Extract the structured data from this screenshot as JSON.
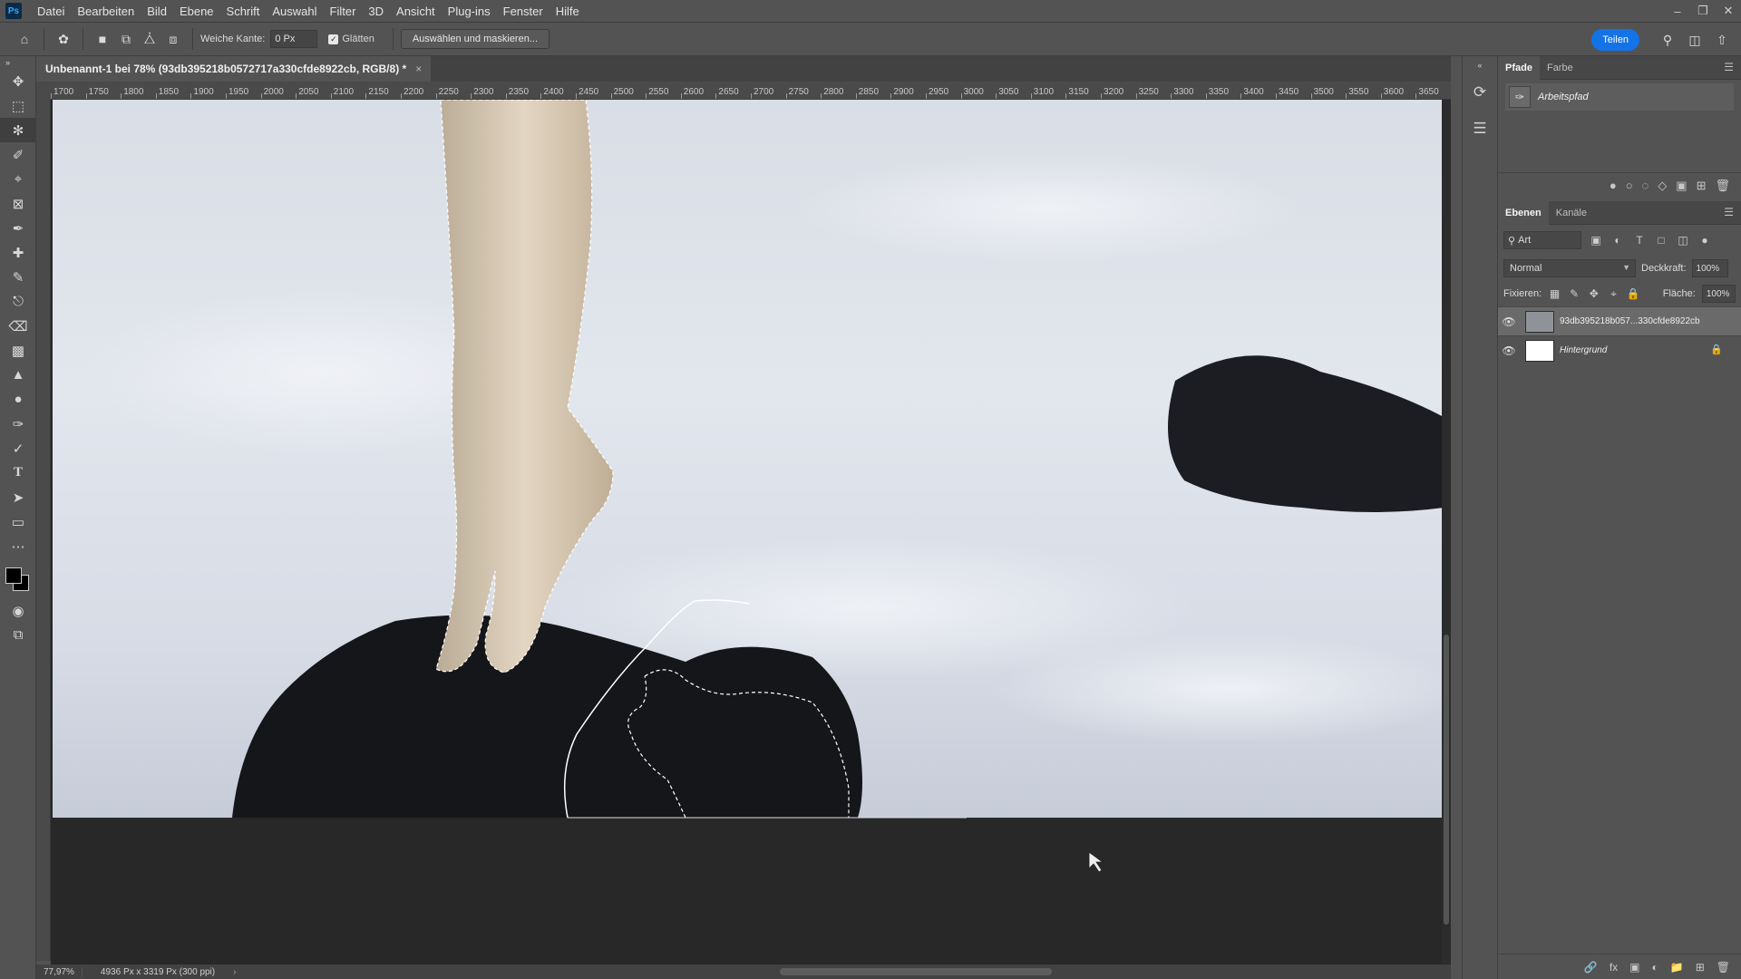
{
  "app": {
    "logo": "Ps"
  },
  "menu": [
    "Datei",
    "Bearbeiten",
    "Bild",
    "Ebene",
    "Schrift",
    "Auswahl",
    "Filter",
    "3D",
    "Ansicht",
    "Plug-ins",
    "Fenster",
    "Hilfe"
  ],
  "options": {
    "feather_label": "Weiche Kante:",
    "feather_value": "0 Px",
    "antialias_label": "Glätten",
    "select_mask_button": "Auswählen und maskieren...",
    "share_button": "Teilen"
  },
  "document": {
    "tab_title": "Unbenannt-1 bei 78% (93db395218b0572717a330cfde8922cb, RGB/8) *",
    "close_glyph": "×"
  },
  "ruler": {
    "ticks": [
      "1700",
      "1750",
      "1800",
      "1850",
      "1900",
      "1950",
      "2000",
      "2050",
      "2100",
      "2150",
      "2200",
      "2250",
      "2300",
      "2350",
      "2400",
      "2450",
      "2500",
      "2550",
      "2600",
      "2650",
      "2700",
      "2750",
      "2800",
      "2850",
      "2900",
      "2950",
      "3000",
      "3050",
      "3100",
      "3150",
      "3200",
      "3250",
      "3300",
      "3350",
      "3400",
      "3450",
      "3500",
      "3550",
      "3600",
      "3650"
    ]
  },
  "status": {
    "zoom": "77,97%",
    "doc_info": "4936 Px x 3319 Px (300 ppi)"
  },
  "paths_panel": {
    "tabs": [
      "Pfade",
      "Farbe"
    ],
    "items": [
      {
        "name": "Arbeitspfad"
      }
    ]
  },
  "layers_panel": {
    "tabs": [
      "Ebenen",
      "Kanäle"
    ],
    "filter_kind": "Art",
    "blend_mode": "Normal",
    "opacity_label": "Deckkraft:",
    "opacity_value": "100%",
    "lock_label": "Fixieren:",
    "fill_label": "Fläche:",
    "fill_value": "100%",
    "layers": [
      {
        "name": "93db395218b057...330cfde8922cb",
        "selected": true
      },
      {
        "name": "Hintergrund",
        "selected": false,
        "locked": true
      }
    ]
  },
  "colors": {
    "accent": "#1473e6",
    "foreground": "#000000",
    "background": "#000000",
    "ui_panel": "#535353"
  },
  "icons": {
    "tools": [
      "move-icon",
      "marquee-icon",
      "lasso-icon",
      "quick-select-icon",
      "crop-icon",
      "frame-icon",
      "eyedropper-icon",
      "healing-icon",
      "brush-icon",
      "stamp-icon",
      "eraser-icon",
      "gradient-icon",
      "blur-icon",
      "dodge-icon",
      "pen-icon",
      "type-icon",
      "path-select-icon",
      "rectangle-icon",
      "more-tools-icon"
    ]
  }
}
